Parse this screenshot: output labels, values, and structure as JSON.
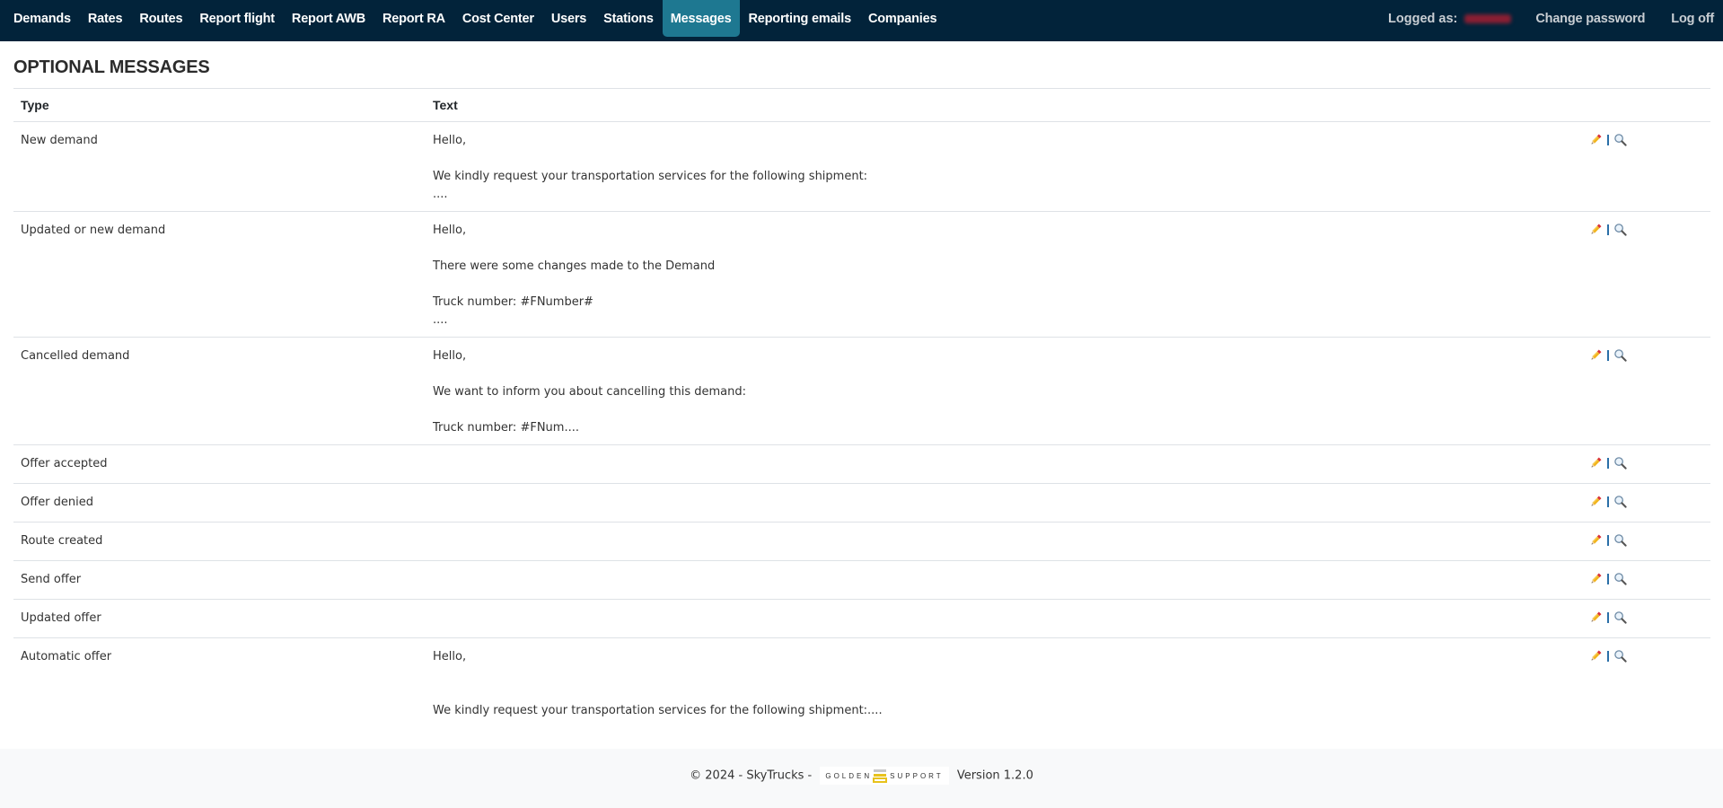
{
  "nav": {
    "items": [
      {
        "label": "Demands",
        "active": false
      },
      {
        "label": "Rates",
        "active": false
      },
      {
        "label": "Routes",
        "active": false
      },
      {
        "label": "Report flight",
        "active": false
      },
      {
        "label": "Report AWB",
        "active": false
      },
      {
        "label": "Report RA",
        "active": false
      },
      {
        "label": "Cost Center",
        "active": false
      },
      {
        "label": "Users",
        "active": false
      },
      {
        "label": "Stations",
        "active": false
      },
      {
        "label": "Messages",
        "active": true
      },
      {
        "label": "Reporting emails",
        "active": false
      },
      {
        "label": "Companies",
        "active": false
      }
    ],
    "logged_as_label": "Logged as:",
    "change_password": "Change password",
    "log_off": "Log off",
    "active_color": "#1e7891",
    "bar_color": "#02233a"
  },
  "page": {
    "title": "OPTIONAL MESSAGES"
  },
  "table": {
    "columns": [
      "Type",
      "Text"
    ],
    "rows": [
      {
        "type": "New demand",
        "text": "Hello,\n\nWe kindly request your transportation services for the following shipment:\n...."
      },
      {
        "type": "Updated or new demand",
        "text": "Hello,\n\nThere were some changes made to the Demand\n\nTruck number: #FNumber#\n...."
      },
      {
        "type": "Cancelled demand",
        "text": "Hello,\n\nWe want to inform you about cancelling this demand:\n\nTruck number: #FNum...."
      },
      {
        "type": "Offer accepted",
        "text": ""
      },
      {
        "type": "Offer denied",
        "text": ""
      },
      {
        "type": "Route created",
        "text": ""
      },
      {
        "type": "Send offer",
        "text": ""
      },
      {
        "type": "Updated offer",
        "text": ""
      },
      {
        "type": "Automatic offer",
        "text": "Hello,\n\n\nWe kindly request your transportation services for the following shipment:...."
      }
    ],
    "actions": {
      "edit_icon": "pencil-icon",
      "view_icon": "magnifier-icon"
    }
  },
  "footer": {
    "copyright": "© 2024 - SkyTrucks -",
    "logo_left": "GOLDEN",
    "logo_right": "SUPPORT",
    "version": "Version 1.2.0"
  }
}
